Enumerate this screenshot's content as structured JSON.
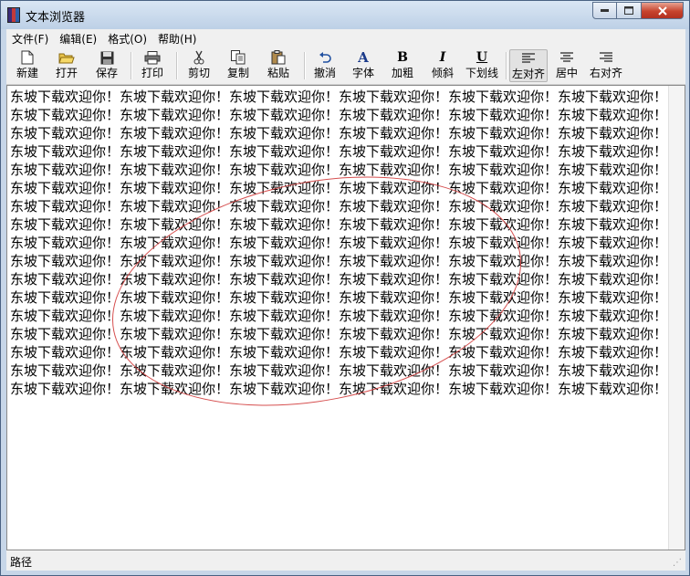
{
  "window": {
    "title": "文本浏览器"
  },
  "menubar": {
    "items": [
      {
        "label": "文件(F)"
      },
      {
        "label": "编辑(E)"
      },
      {
        "label": "格式(O)"
      },
      {
        "label": "帮助(H)"
      }
    ]
  },
  "toolbar": {
    "new": {
      "label": "新建",
      "icon": "new-file-icon"
    },
    "open": {
      "label": "打开",
      "icon": "open-folder-icon"
    },
    "save": {
      "label": "保存",
      "icon": "save-disk-icon"
    },
    "print": {
      "label": "打印",
      "icon": "printer-icon"
    },
    "cut": {
      "label": "剪切",
      "icon": "scissors-icon"
    },
    "copy": {
      "label": "复制",
      "icon": "copy-icon"
    },
    "paste": {
      "label": "粘贴",
      "icon": "paste-icon"
    },
    "undo": {
      "label": "撤消",
      "icon": "undo-icon"
    },
    "font": {
      "label": "字体",
      "icon": "font-A-icon",
      "glyph": "A"
    },
    "bold": {
      "label": "加粗",
      "icon": "bold-icon",
      "glyph": "B"
    },
    "italic": {
      "label": "倾斜",
      "icon": "italic-icon",
      "glyph": "I"
    },
    "underline": {
      "label": "下划线",
      "icon": "underline-icon",
      "glyph": "U"
    },
    "align_left": {
      "label": "左对齐",
      "icon": "align-left-icon",
      "active": true
    },
    "align_center": {
      "label": "居中",
      "icon": "align-center-icon"
    },
    "align_right": {
      "label": "右对齐",
      "icon": "align-right-icon"
    }
  },
  "editor": {
    "text": "东坡下载欢迎你！东坡下载欢迎你！东坡下载欢迎你！东坡下载欢迎你！东坡下载欢迎你！东坡下载欢迎你！东坡下载欢迎你！东坡下载欢迎你！东坡下载欢迎你！东坡下载欢迎你！东坡下载欢迎你！东坡下载欢迎你！东坡下载欢迎你！东坡下载欢迎你！东坡下载欢迎你！东坡下载欢迎你！东坡下载欢迎你！东坡下载欢迎你！东坡下载欢迎你！东坡下载欢迎你！东坡下载欢迎你！东坡下载欢迎你！东坡下载欢迎你！东坡下载欢迎你！东坡下载欢迎你！东坡下载欢迎你！东坡下载欢迎你！东坡下载欢迎你！东坡下载欢迎你！东坡下载欢迎你！东坡下载欢迎你！东坡下载欢迎你！东坡下载欢迎你！东坡下载欢迎你！东坡下载欢迎你！东坡下载欢迎你！东坡下载欢迎你！东坡下载欢迎你！东坡下载欢迎你！东坡下载欢迎你！东坡下载欢迎你！东坡下载欢迎你！东坡下载欢迎你！东坡下载欢迎你！东坡下载欢迎你！东坡下载欢迎你！东坡下载欢迎你！东坡下载欢迎你！东坡下载欢迎你！东坡下载欢迎你！东坡下载欢迎你！东坡下载欢迎你！东坡下载欢迎你！东坡下载欢迎你！东坡下载欢迎你！东坡下载欢迎你！东坡下载欢迎你！东坡下载欢迎你！东坡下载欢迎你！东坡下载欢迎你！东坡下载欢迎你！东坡下载欢迎你！东坡下载欢迎你！东坡下载欢迎你！东坡下载欢迎你！东坡下载欢迎你！东坡下载欢迎你！东坡下载欢迎你！东坡下载欢迎你！东坡下载欢迎你！东坡下载欢迎你！东坡下载欢迎你！东坡下载欢迎你！东坡下载欢迎你！东坡下载欢迎你！东坡下载欢迎你！东坡下载欢迎你！东坡下载欢迎你！东坡下载欢迎你！东坡下载欢迎你！东坡下载欢迎你！东坡下载欢迎你！东坡下载欢迎你！东坡下载欢迎你！东坡下载欢迎你！东坡下载欢迎你！东坡下载欢迎你！东坡下载欢迎你！东坡下载欢迎你！东坡下载欢迎你！东坡下载欢迎你！东坡下载欢迎你！东坡下载欢迎你！东坡下载欢迎你！东坡下载欢迎你！东坡下载欢迎你！东坡下载欢迎你！东坡下载欢迎你！东坡下载欢迎你！东坡下载欢迎你！东坡下载欢迎你！东坡下载欢迎你！"
  },
  "statusbar": {
    "text": "路径"
  },
  "colors": {
    "title_bg": "#c7d6e8",
    "close": "#c7432d",
    "annotation": "#d23c3c"
  }
}
